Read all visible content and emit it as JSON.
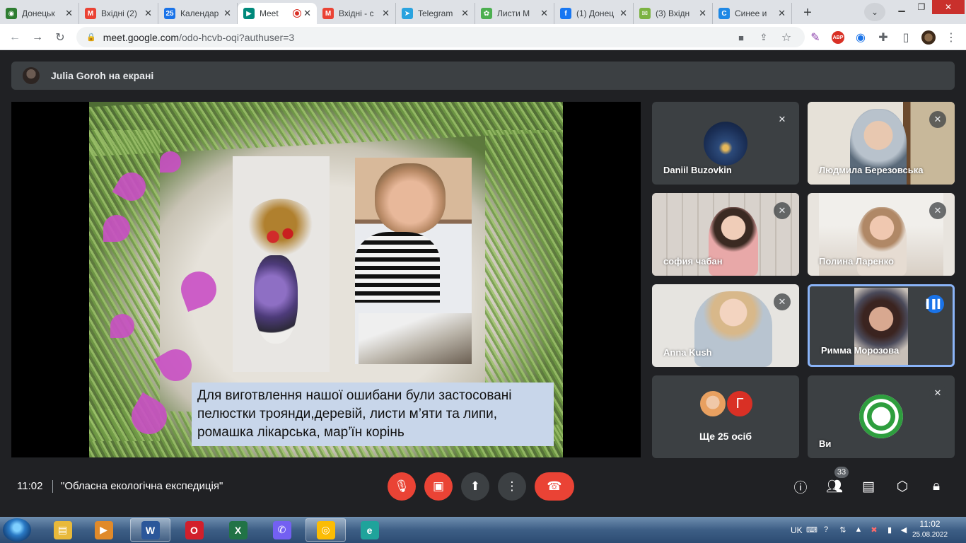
{
  "browser": {
    "tabs": [
      {
        "label": "Донецьк",
        "fav_color": "#2e7d32",
        "fav_glyph": "◉"
      },
      {
        "label": "Вхідні (2)",
        "fav_color": "#ea4335",
        "fav_glyph": "M"
      },
      {
        "label": "Календар",
        "fav_color": "#1a73e8",
        "fav_glyph": "25"
      },
      {
        "label": "Meet",
        "fav_color": "#00897b",
        "fav_glyph": "▶",
        "active": true
      },
      {
        "label": "Вхідні - с",
        "fav_color": "#ea4335",
        "fav_glyph": "M"
      },
      {
        "label": "Telegram",
        "fav_color": "#2aa3df",
        "fav_glyph": "➤"
      },
      {
        "label": "Листи М",
        "fav_color": "#4caf50",
        "fav_glyph": "✿"
      },
      {
        "label": "(1) Донец",
        "fav_color": "#1877f2",
        "fav_glyph": "f"
      },
      {
        "label": "(3) Вхідн",
        "fav_color": "#7cb342",
        "fav_glyph": "✉"
      },
      {
        "label": "Синее и",
        "fav_color": "#1e88e5",
        "fav_glyph": "C"
      }
    ],
    "new_tab_glyph": "+",
    "url_host": "meet.google.com",
    "url_path": "/odo-hcvb-oqi?authuser=3",
    "ext_abp": "ABP"
  },
  "meet": {
    "presenting_banner": "Julia Goroh на екрані",
    "slide_caption": "Для виготвлення нашої ошибани були застосовані пелюстки троянди,деревій, листи м’яти та липи, ромашка лікарська, мар’їн корінь",
    "participants": [
      {
        "name": "Daniil Buzovkin"
      },
      {
        "name": "Людмила Березовська"
      },
      {
        "name": "софия чабан"
      },
      {
        "name": "Полина Ларенко"
      },
      {
        "name": "Anna Kush"
      },
      {
        "name": "Римма Морозова"
      },
      {
        "name": "Ви"
      }
    ],
    "more_people": {
      "label": "Ще 25 осіб",
      "second_initial": "Г",
      "second_color": "#d93025"
    },
    "time": "11:02",
    "meeting_name": "\"Обласна екологічна експедиція\"",
    "people_count": "33"
  },
  "taskbar": {
    "apps": [
      {
        "name": "explorer",
        "glyph": "▤",
        "color": "#e8b93a"
      },
      {
        "name": "media",
        "glyph": "▶",
        "color": "#e08a2a"
      },
      {
        "name": "word",
        "glyph": "W",
        "color": "#2b579a"
      },
      {
        "name": "opera",
        "glyph": "O",
        "color": "#d21f2b"
      },
      {
        "name": "excel",
        "glyph": "X",
        "color": "#217346"
      },
      {
        "name": "viber",
        "glyph": "✆",
        "color": "#7360f2"
      },
      {
        "name": "chrome",
        "glyph": "◎",
        "color": "#fbbc04"
      },
      {
        "name": "edge",
        "glyph": "e",
        "color": "#1fa39b"
      }
    ],
    "lang": "UK",
    "time": "11:02",
    "date": "25.08.2022"
  }
}
